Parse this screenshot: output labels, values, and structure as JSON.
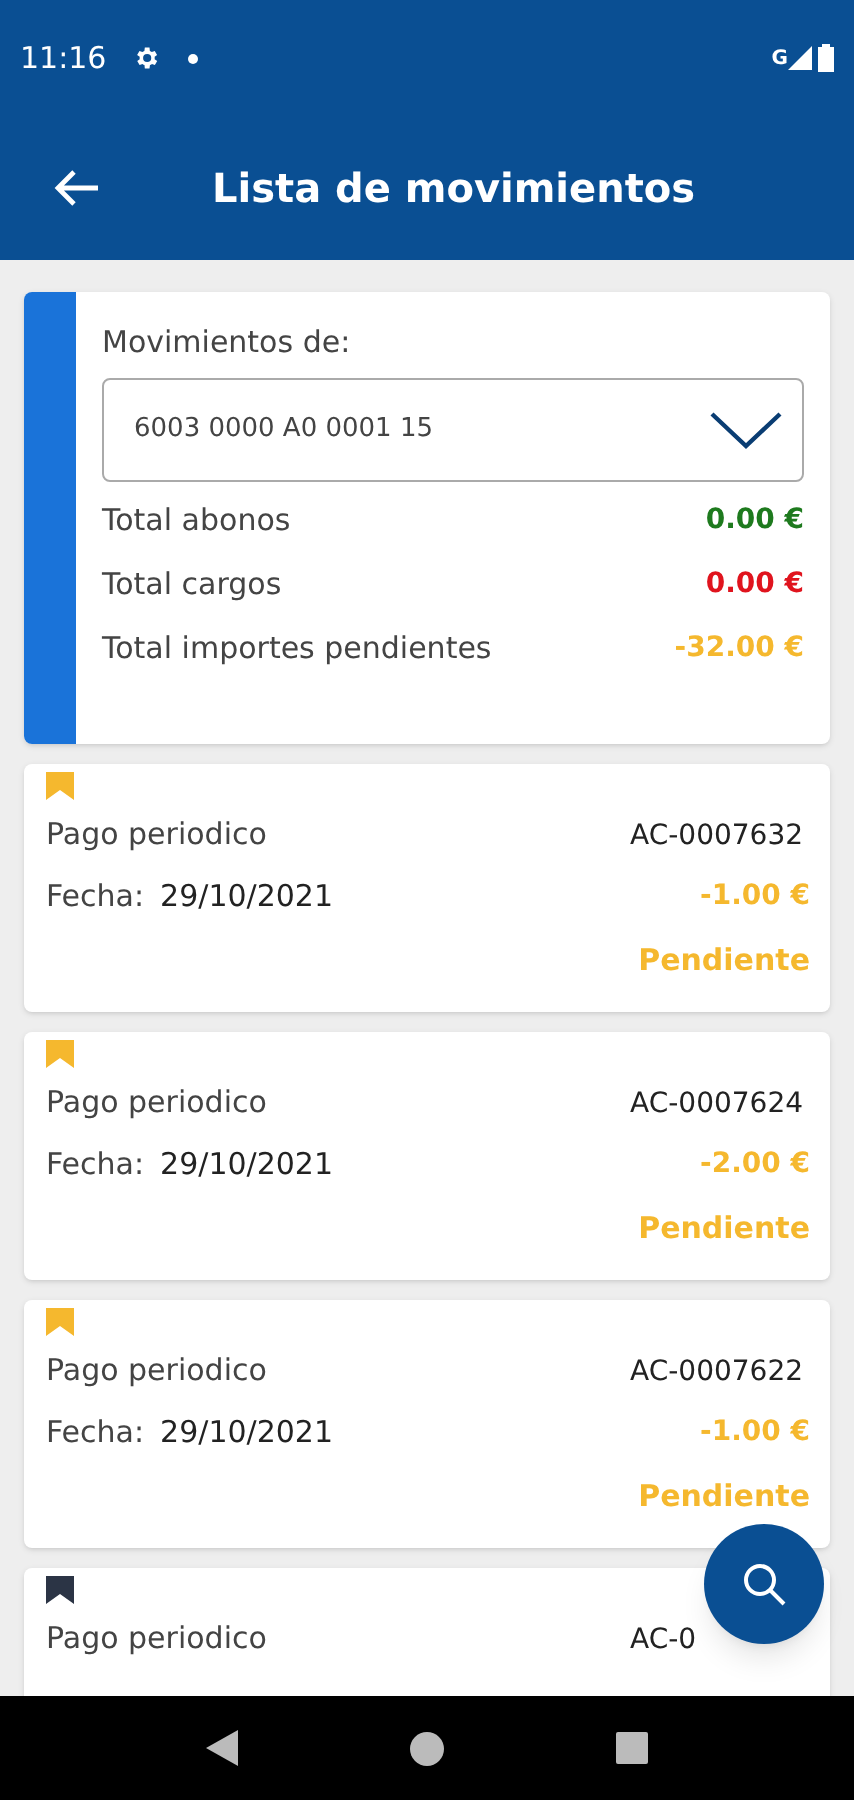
{
  "status_bar": {
    "time": "11:16",
    "network": "G"
  },
  "app_bar": {
    "title": "Lista de movimientos"
  },
  "summary": {
    "label": "Movimientos de:",
    "account": "6003 0000 A0 0001 15",
    "totals": [
      {
        "label": "Total abonos",
        "value": "0.00 €",
        "color": "#1e7a1e"
      },
      {
        "label": "Total cargos",
        "value": "0.00 €",
        "color": "#e0141e"
      },
      {
        "label": "Total importes pendientes",
        "value": "-32.00 €",
        "color": "#f5b82e"
      }
    ]
  },
  "movements": [
    {
      "concept": "Pago periodico",
      "reference": "AC-0007632",
      "date_label": "Fecha:",
      "date": "29/10/2021",
      "amount": "-1.00 €",
      "status": "Pendiente",
      "color": "#f5b82e"
    },
    {
      "concept": "Pago periodico",
      "reference": "AC-0007624",
      "date_label": "Fecha:",
      "date": "29/10/2021",
      "amount": "-2.00 €",
      "status": "Pendiente",
      "color": "#f5b82e"
    },
    {
      "concept": "Pago periodico",
      "reference": "AC-0007622",
      "date_label": "Fecha:",
      "date": "29/10/2021",
      "amount": "-1.00 €",
      "status": "Pendiente",
      "color": "#f5b82e"
    },
    {
      "concept": "Pago periodico",
      "reference": "AC-0",
      "color": "#2b3445"
    }
  ]
}
